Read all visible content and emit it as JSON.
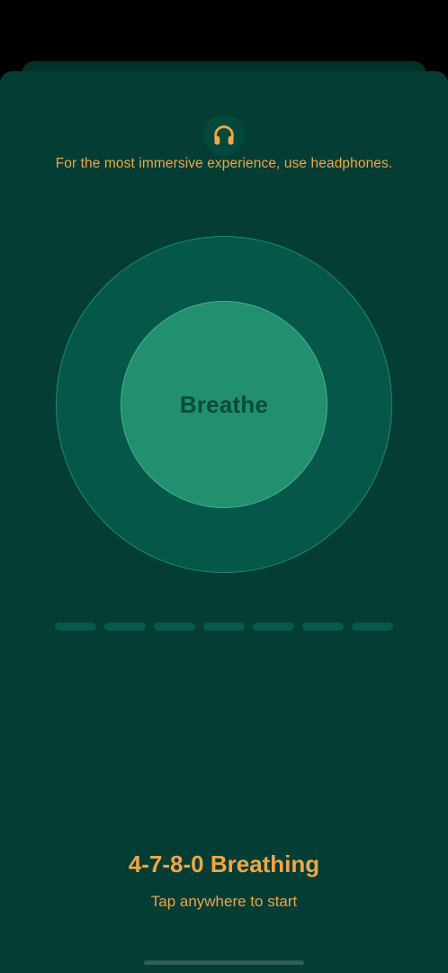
{
  "colors": {
    "accent": "#f0a649",
    "sheet_background": "#033d33",
    "outer_ring": "#05574a",
    "inner_circle": "#22906f"
  },
  "header": {
    "icon": "headphones-icon",
    "hint": "For the most immersive experience, use headphones."
  },
  "breath_circle": {
    "label": "Breathe"
  },
  "progress": {
    "segments": 7,
    "completed": 0
  },
  "footer": {
    "title": "4-7-8-0 Breathing",
    "subtitle": "Tap anywhere to start"
  }
}
